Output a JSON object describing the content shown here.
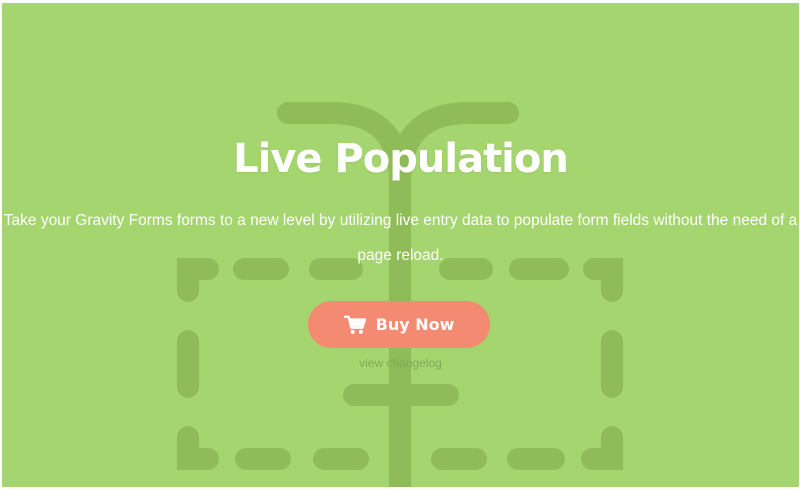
{
  "hero": {
    "title": "Live Population",
    "description": "Take your Gravity Forms forms to a new level by utilizing live entry data to populate form fields without the need of a page reload.",
    "buy_button": {
      "label": "Buy Now",
      "icon": "shopping-cart-icon"
    },
    "changelog_link": "view changelog"
  },
  "colors": {
    "background": "#a5d56e",
    "illustration": "#8fbc58",
    "button": "#f58a72",
    "text": "#ffffff",
    "link": "#7fa85a"
  }
}
